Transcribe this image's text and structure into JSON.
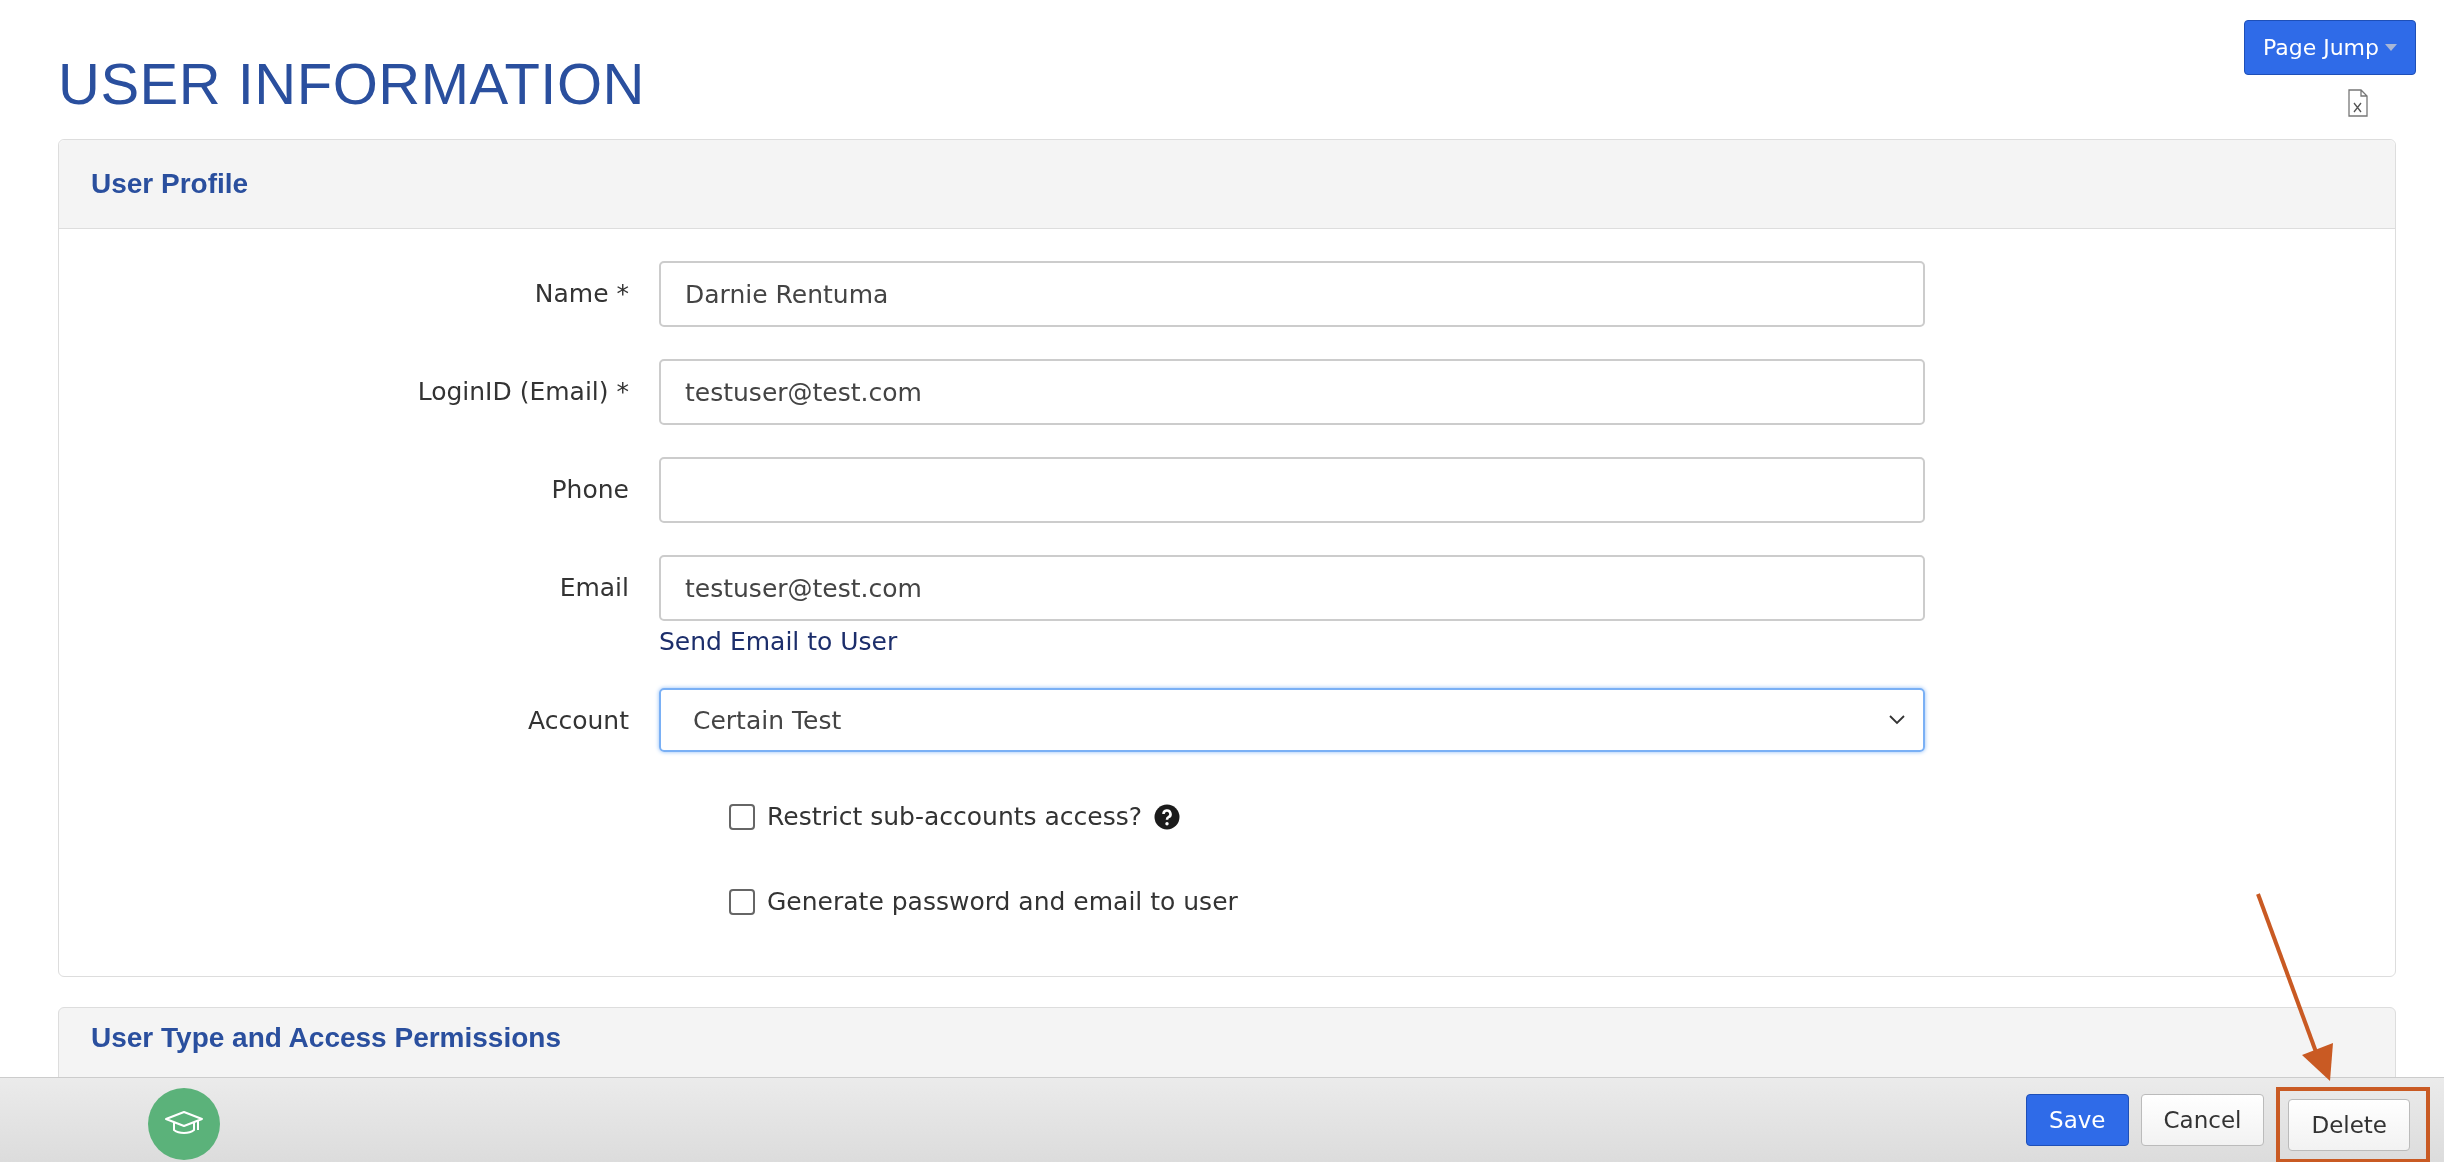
{
  "page": {
    "title": "USER INFORMATION",
    "page_jump_button": "Page Jump"
  },
  "user_profile": {
    "title": "User Profile",
    "fields": [
      {
        "kind": "text",
        "label": "Name *",
        "value": "Darnie Rentuma"
      },
      {
        "kind": "text",
        "label": "LoginID (Email) *",
        "value": "testuser@test.com"
      },
      {
        "kind": "text",
        "label": "Phone"
      },
      {
        "kind": "text",
        "label": "Email",
        "value": "testuser@test.com",
        "link": "Send Email to User"
      },
      {
        "kind": "select",
        "label": "Account",
        "value": "Certain Test",
        "focused": true
      }
    ],
    "checkboxes": [
      {
        "label": "Restrict sub-accounts access?",
        "checked": false,
        "help": true
      },
      {
        "label": "Generate password and email to user",
        "checked": false
      }
    ]
  },
  "next_section": {
    "title": "User Type and Access Permissions"
  },
  "footer": {
    "buttons": [
      {
        "kind": "primary",
        "label": "Save"
      },
      {
        "kind": "default",
        "label": "Cancel"
      },
      {
        "kind": "default",
        "label": "Delete",
        "highlighted": true
      }
    ]
  }
}
